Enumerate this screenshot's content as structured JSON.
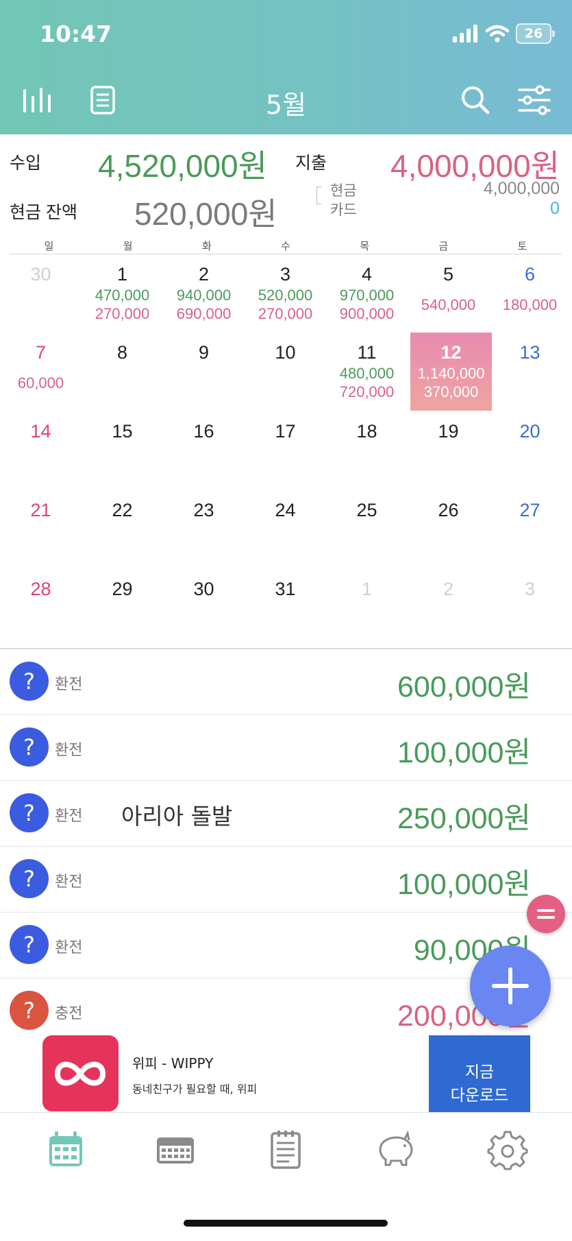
{
  "status": {
    "time": "10:47",
    "battery": "26"
  },
  "header": {
    "title": "5월",
    "icons": [
      "stats-icon",
      "list-icon",
      "search-icon",
      "filter-icon"
    ]
  },
  "summary": {
    "income_label": "수입",
    "income_value": "4,520,000원",
    "expense_label": "지출",
    "expense_value": "4,000,000원",
    "balance_label": "현금 잔액",
    "balance_value": "520,000원",
    "cash_label": "현금",
    "cash_value": "4,000,000",
    "card_label": "카드",
    "card_value": "0"
  },
  "calendar": {
    "weekdays": [
      "일",
      "월",
      "화",
      "수",
      "목",
      "금",
      "토"
    ],
    "days": [
      {
        "n": "30",
        "inc": "",
        "exp": "",
        "other": true
      },
      {
        "n": "1",
        "inc": "470,000",
        "exp": "270,000"
      },
      {
        "n": "2",
        "inc": "940,000",
        "exp": "690,000"
      },
      {
        "n": "3",
        "inc": "520,000",
        "exp": "270,000"
      },
      {
        "n": "4",
        "inc": "970,000",
        "exp": "900,000"
      },
      {
        "n": "5",
        "inc": "",
        "exp": "540,000"
      },
      {
        "n": "6",
        "inc": "",
        "exp": "180,000"
      },
      {
        "n": "7",
        "inc": "",
        "exp": "60,000"
      },
      {
        "n": "8",
        "inc": "",
        "exp": ""
      },
      {
        "n": "9",
        "inc": "",
        "exp": ""
      },
      {
        "n": "10",
        "inc": "",
        "exp": ""
      },
      {
        "n": "11",
        "inc": "480,000",
        "exp": "720,000"
      },
      {
        "n": "12",
        "inc": "1,140,000",
        "exp": "370,000",
        "selected": true
      },
      {
        "n": "13",
        "inc": "",
        "exp": ""
      },
      {
        "n": "14",
        "inc": "",
        "exp": ""
      },
      {
        "n": "15",
        "inc": "",
        "exp": ""
      },
      {
        "n": "16",
        "inc": "",
        "exp": ""
      },
      {
        "n": "17",
        "inc": "",
        "exp": ""
      },
      {
        "n": "18",
        "inc": "",
        "exp": ""
      },
      {
        "n": "19",
        "inc": "",
        "exp": ""
      },
      {
        "n": "20",
        "inc": "",
        "exp": ""
      },
      {
        "n": "21",
        "inc": "",
        "exp": ""
      },
      {
        "n": "22",
        "inc": "",
        "exp": ""
      },
      {
        "n": "23",
        "inc": "",
        "exp": ""
      },
      {
        "n": "24",
        "inc": "",
        "exp": ""
      },
      {
        "n": "25",
        "inc": "",
        "exp": ""
      },
      {
        "n": "26",
        "inc": "",
        "exp": ""
      },
      {
        "n": "27",
        "inc": "",
        "exp": ""
      },
      {
        "n": "28",
        "inc": "",
        "exp": ""
      },
      {
        "n": "29",
        "inc": "",
        "exp": ""
      },
      {
        "n": "30",
        "inc": "",
        "exp": ""
      },
      {
        "n": "31",
        "inc": "",
        "exp": ""
      },
      {
        "n": "1",
        "inc": "",
        "exp": "",
        "other": true
      },
      {
        "n": "2",
        "inc": "",
        "exp": "",
        "other": true
      },
      {
        "n": "3",
        "inc": "",
        "exp": "",
        "other": true
      }
    ]
  },
  "transactions": [
    {
      "cat": "환전",
      "memo": "",
      "amount": "600,000원",
      "type": "income",
      "icon_color": "#3b5be0"
    },
    {
      "cat": "환전",
      "memo": "",
      "amount": "100,000원",
      "type": "income",
      "icon_color": "#3b5be0"
    },
    {
      "cat": "환전",
      "memo": "아리아 돌발",
      "amount": "250,000원",
      "type": "income",
      "icon_color": "#3b5be0"
    },
    {
      "cat": "환전",
      "memo": "",
      "amount": "100,000원",
      "type": "income",
      "icon_color": "#3b5be0"
    },
    {
      "cat": "환전",
      "memo": "",
      "amount": "90,000원",
      "type": "income",
      "icon_color": "#3b5be0"
    },
    {
      "cat": "충전",
      "memo": "",
      "amount": "200,000원",
      "type": "expense",
      "icon_color": "#d9553f"
    }
  ],
  "ad": {
    "app_name": "위피 - WIPPY",
    "tagline": "동네친구가 필요할 때, 위피",
    "cta_line1": "지금",
    "cta_line2": "다운로드"
  },
  "colors": {
    "income": "#4a9a5a",
    "expense": "#d86283",
    "sunday": "#e23e7a",
    "saturday": "#3a6bd1",
    "header": "#74c2c3",
    "fab": "#6a86f2"
  },
  "tabs": [
    "calendar-icon",
    "week-icon",
    "notes-icon",
    "piggy-bank-icon",
    "gear-icon"
  ]
}
